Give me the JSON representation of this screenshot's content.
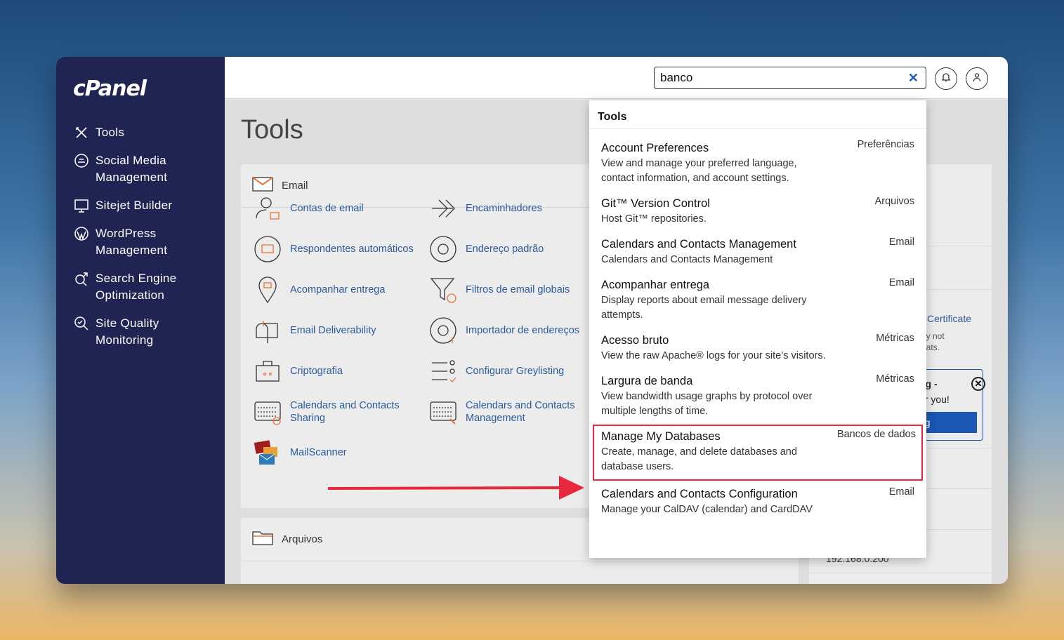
{
  "app": {
    "logo": "cPanel"
  },
  "sidebar": {
    "items": [
      {
        "label": "Tools",
        "icon": "tools-icon"
      },
      {
        "label": "Social Media Management",
        "icon": "social-media-icon"
      },
      {
        "label": "Sitejet Builder",
        "icon": "sitejet-icon"
      },
      {
        "label": "WordPress Management",
        "icon": "wordpress-icon"
      },
      {
        "label": "Search Engine Optimization",
        "icon": "seo-icon"
      },
      {
        "label": "Site Quality Monitoring",
        "icon": "site-quality-icon"
      }
    ]
  },
  "search": {
    "value": "banco",
    "clear": "✕"
  },
  "main": {
    "title": "Tools",
    "email_panel": {
      "title": "Email",
      "tools": [
        {
          "label": "Contas de email"
        },
        {
          "label": "Encaminhadores"
        },
        {
          "label": "Respondentes automáticos"
        },
        {
          "label": "Endereço padrão"
        },
        {
          "label": "Acompanhar entrega"
        },
        {
          "label": "Filtros de email globais"
        },
        {
          "label": "Email Deliverability"
        },
        {
          "label": "Importador de endereços"
        },
        {
          "label": "Criptografia"
        },
        {
          "label": "Configurar Greylisting"
        },
        {
          "label": "Calendars and Contacts Sharing"
        },
        {
          "label": "Calendars and Contacts Management"
        },
        {
          "label": "MailScanner"
        }
      ]
    },
    "files_panel": {
      "title": "Arquivos"
    },
    "right_panel": {
      "certificate": "Certificate",
      "cert_note_1": "ay not",
      "cert_note_2": "eats.",
      "promo_1": "ng -",
      "promo_2": "or you!",
      "promo_btn": "ng",
      "ip": "192.168.0.200"
    }
  },
  "dropdown": {
    "heading": "Tools",
    "results": [
      {
        "title": "Account Preferences",
        "desc": "View and manage your preferred language, contact information, and account settings.",
        "category": "Preferências"
      },
      {
        "title": "Git™ Version Control",
        "desc": "Host Git™ repositories.",
        "category": "Arquivos"
      },
      {
        "title": "Calendars and Contacts Management",
        "desc": "Calendars and Contacts Management",
        "category": "Email"
      },
      {
        "title": "Acompanhar entrega",
        "desc": "Display reports about email message delivery attempts.",
        "category": "Email"
      },
      {
        "title": "Acesso bruto",
        "desc": "View the raw Apache® logs for your site’s visitors.",
        "category": "Métricas"
      },
      {
        "title": "Largura de banda",
        "desc": "View bandwidth usage graphs by protocol over multiple lengths of time.",
        "category": "Métricas"
      },
      {
        "title": "Manage My Databases",
        "desc": "Create, manage, and delete databases and database users.",
        "category": "Bancos de dados"
      },
      {
        "title": "Calendars and Contacts Configuration",
        "desc": "Manage your CalDAV (calendar) and CardDAV",
        "category": "Email"
      }
    ]
  },
  "colors": {
    "sidebar": "#202452",
    "link": "#2a5a9c",
    "highlight": "#e8283c",
    "accent": "#e8743b"
  }
}
